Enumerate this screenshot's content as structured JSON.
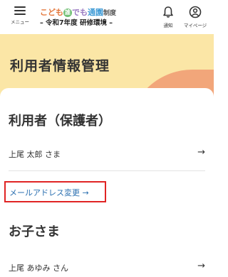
{
  "header": {
    "menu_label": "メニュー",
    "logo": {
      "part1": "こども",
      "part2": "誰",
      "part3": "でも",
      "part4": "通園",
      "part5": "制度"
    },
    "subtitle": "– 令和7年度 研修環境 –",
    "notifications_label": "通知",
    "mypage_label": "マイページ"
  },
  "page": {
    "title": "利用者情報管理"
  },
  "guardian_section": {
    "heading": "利用者（保護者）",
    "name": "上尾 太郎 さま",
    "arrow": "→",
    "email_change_label": "メールアドレス変更 →"
  },
  "child_section": {
    "heading": "お子さま",
    "name": "上尾 あゆみ さん",
    "arrow": "→"
  },
  "colors": {
    "band": "#fbe6a6",
    "blob": "#f2a67a",
    "link": "#2a6fb0",
    "highlight": "#e02424"
  }
}
